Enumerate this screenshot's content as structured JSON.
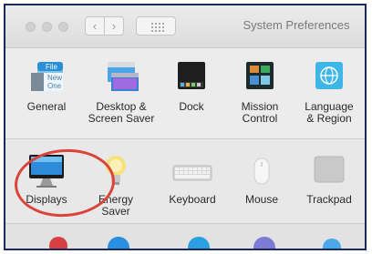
{
  "window": {
    "title": "System Preferences"
  },
  "toolbar": {
    "back_glyph": "‹",
    "forward_glyph": "›"
  },
  "row1": [
    {
      "label": "General",
      "icon": "general-icon"
    },
    {
      "label": "Desktop &\nScreen Saver",
      "icon": "desktop-screensaver-icon"
    },
    {
      "label": "Dock",
      "icon": "dock-icon"
    },
    {
      "label": "Mission\nControl",
      "icon": "mission-control-icon"
    },
    {
      "label": "Language\n& Region",
      "icon": "globe-icon"
    }
  ],
  "row2": [
    {
      "label": "Displays",
      "icon": "display-icon"
    },
    {
      "label": "Energy\nSaver",
      "icon": "lightbulb-icon"
    },
    {
      "label": "Keyboard",
      "icon": "keyboard-icon"
    },
    {
      "label": "Mouse",
      "icon": "mouse-icon"
    },
    {
      "label": "Trackpad",
      "icon": "trackpad-icon"
    }
  ],
  "general_icon_text": [
    "File",
    "New",
    "One"
  ],
  "colors": {
    "highlight": "#d9453b",
    "frame": "#1e2a5a"
  }
}
